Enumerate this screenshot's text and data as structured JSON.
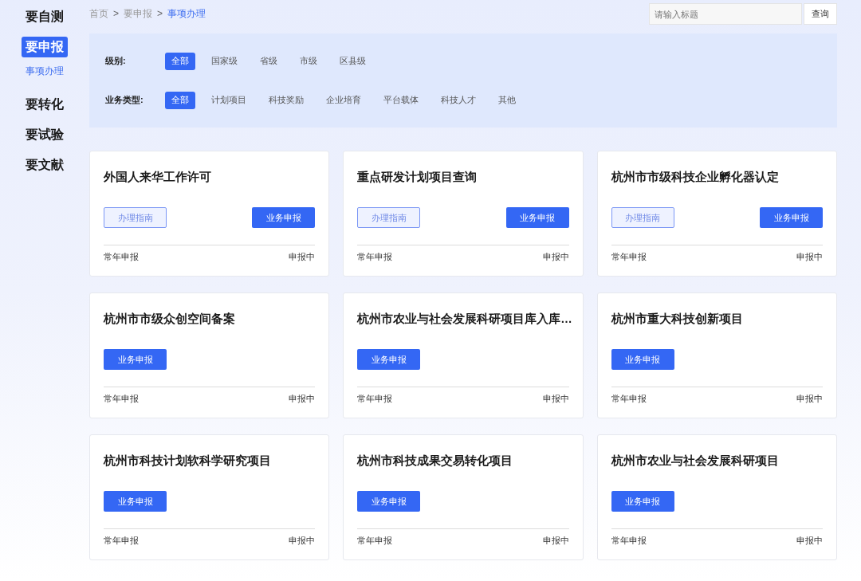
{
  "sidebar": {
    "items": [
      {
        "label": "要自测",
        "selected": false
      },
      {
        "label": "要申报",
        "selected": true,
        "children": [
          {
            "label": "事项办理",
            "selected": true
          }
        ]
      },
      {
        "label": "要转化",
        "selected": false
      },
      {
        "label": "要试验",
        "selected": false
      },
      {
        "label": "要文献",
        "selected": false
      }
    ]
  },
  "breadcrumb": [
    {
      "label": "首页",
      "selected": false
    },
    {
      "label": "要申报",
      "selected": false
    },
    {
      "label": "事项办理",
      "selected": true
    }
  ],
  "breadcrumb_separator": ">",
  "search": {
    "placeholder": "请输入标题",
    "button": "查询"
  },
  "filters": [
    {
      "label": "级别:",
      "options": [
        {
          "label": "全部",
          "selected": true
        },
        {
          "label": "国家级",
          "selected": false
        },
        {
          "label": "省级",
          "selected": false
        },
        {
          "label": "市级",
          "selected": false
        },
        {
          "label": "区县级",
          "selected": false
        }
      ]
    },
    {
      "label": "业务类型:",
      "options": [
        {
          "label": "全部",
          "selected": true
        },
        {
          "label": "计划项目",
          "selected": false
        },
        {
          "label": "科技奖励",
          "selected": false
        },
        {
          "label": "企业培育",
          "selected": false
        },
        {
          "label": "平台载体",
          "selected": false
        },
        {
          "label": "科技人才",
          "selected": false
        },
        {
          "label": "其他",
          "selected": false
        }
      ]
    }
  ],
  "cards": [
    {
      "title": "外国人来华工作许可",
      "buttons": [
        {
          "kind": "guide",
          "label": "办理指南"
        },
        {
          "kind": "apply",
          "label": "业务申报"
        }
      ],
      "period": "常年申报",
      "status": "申报中"
    },
    {
      "title": "重点研发计划项目查询",
      "buttons": [
        {
          "kind": "guide",
          "label": "办理指南"
        },
        {
          "kind": "apply",
          "label": "业务申报"
        }
      ],
      "period": "常年申报",
      "status": "申报中"
    },
    {
      "title": "杭州市市级科技企业孵化器认定",
      "buttons": [
        {
          "kind": "guide",
          "label": "办理指南"
        },
        {
          "kind": "apply",
          "label": "业务申报"
        }
      ],
      "period": "常年申报",
      "status": "申报中"
    },
    {
      "title": "杭州市市级众创空间备案",
      "buttons": [
        {
          "kind": "apply",
          "label": "业务申报"
        }
      ],
      "period": "常年申报",
      "status": "申报中"
    },
    {
      "title": "杭州市农业与社会发展科研项目库入库…",
      "buttons": [
        {
          "kind": "apply",
          "label": "业务申报"
        }
      ],
      "period": "常年申报",
      "status": "申报中"
    },
    {
      "title": "杭州市重大科技创新项目",
      "buttons": [
        {
          "kind": "apply",
          "label": "业务申报"
        }
      ],
      "period": "常年申报",
      "status": "申报中"
    },
    {
      "title": "杭州市科技计划软科学研究项目",
      "buttons": [
        {
          "kind": "apply",
          "label": "业务申报"
        }
      ],
      "period": "常年申报",
      "status": "申报中"
    },
    {
      "title": "杭州市科技成果交易转化项目",
      "buttons": [
        {
          "kind": "apply",
          "label": "业务申报"
        }
      ],
      "period": "常年申报",
      "status": "申报中"
    },
    {
      "title": "杭州市农业与社会发展科研项目",
      "buttons": [
        {
          "kind": "apply",
          "label": "业务申报"
        }
      ],
      "period": "常年申报",
      "status": "申报中"
    }
  ]
}
